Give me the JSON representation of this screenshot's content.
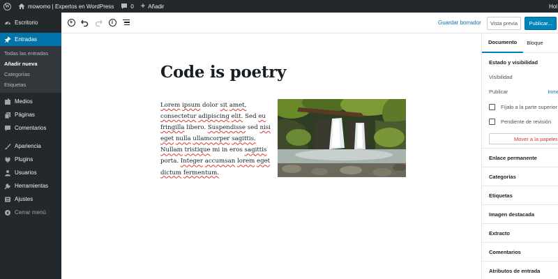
{
  "admin_bar": {
    "site_name": "mowomo | Expertos en WordPress",
    "comments_count": "0",
    "new_label": "Añadir",
    "greeting": "Hol"
  },
  "sidebar": {
    "items": [
      {
        "label": "Escritorio",
        "icon": "dashboard-icon"
      },
      {
        "label": "Entradas",
        "icon": "pin-icon",
        "active": true
      },
      {
        "label": "Medios",
        "icon": "media-icon"
      },
      {
        "label": "Páginas",
        "icon": "pages-icon"
      },
      {
        "label": "Comentarios",
        "icon": "comments-icon"
      },
      {
        "label": "Apariencia",
        "icon": "appearance-icon"
      },
      {
        "label": "Plugins",
        "icon": "plugins-icon"
      },
      {
        "label": "Usuarios",
        "icon": "users-icon"
      },
      {
        "label": "Herramientas",
        "icon": "tools-icon"
      },
      {
        "label": "Ajustes",
        "icon": "settings-icon"
      }
    ],
    "submenu": [
      "Todas las entradas",
      "Añadir nueva",
      "Categorías",
      "Etiquetas"
    ],
    "collapse_label": "Cerrar menú"
  },
  "toolbar": {
    "save_draft": "Guardar borrador",
    "preview": "Vista previa",
    "publish": "Publicar..."
  },
  "post": {
    "title": "Code is poetry",
    "paragraph_words": [
      "Lorem",
      "ipsum",
      "dolor",
      "sit",
      "amet,",
      "consectetur",
      "adipiscing",
      "elit.",
      "Sed",
      "eu",
      "fringilla",
      "libero.",
      "Suspendisse",
      "sed",
      "nisi",
      "eget",
      "nulla",
      "ullamcorper",
      "sagittis.",
      "Nullam",
      "tristique",
      "mi",
      "in",
      "eros",
      "sagittis",
      "porta.",
      "Integer",
      "accumsan",
      "lorem",
      "eget",
      "dictum",
      "fermentum."
    ]
  },
  "settings": {
    "tabs": [
      "Documento",
      "Bloque"
    ],
    "status_title": "Estado y visibilidad",
    "visibility_label": "Visibilidad",
    "publish_label": "Publicar",
    "publish_value": "Inme",
    "sticky_label": "Fíjalo a la parte superior de",
    "pending_label": "Pendiente de revisión",
    "trash_label": "Mover a la papelera",
    "panels": [
      "Enlace permanente",
      "Categorías",
      "Etiquetas",
      "Imagen destacada",
      "Extracto",
      "Comentarios",
      "Atributos de entrada"
    ]
  },
  "colors": {
    "admin_dark": "#23282d",
    "accent": "#0073aa",
    "primary_button": "#0085ba",
    "spellcheck": "#d63638"
  }
}
